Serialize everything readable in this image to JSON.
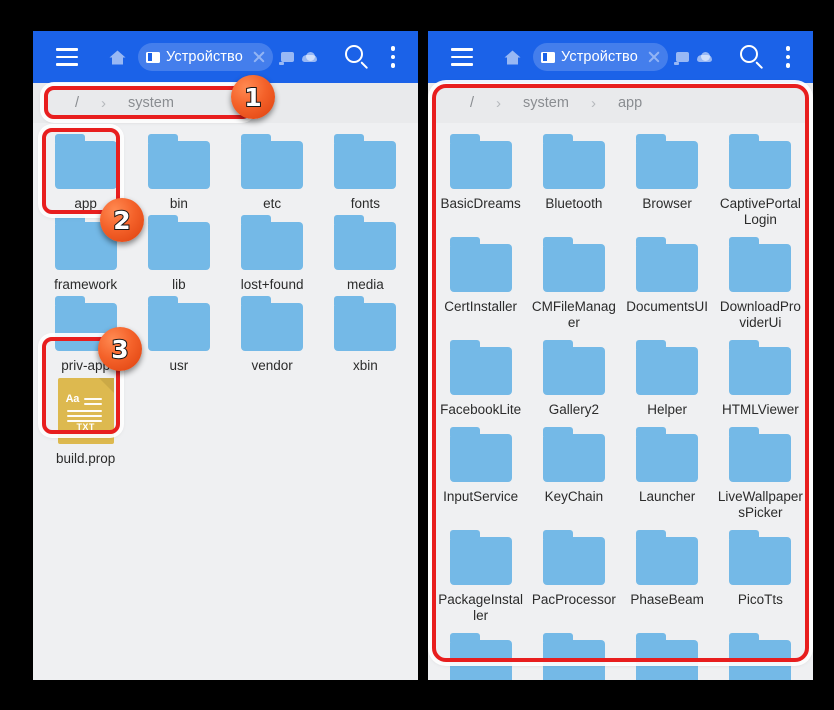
{
  "toolbar": {
    "menu_icon": "hamburger-menu-icon",
    "home_icon": "home-icon",
    "tab_label": "Устройство",
    "tab_close_icon": "close-icon",
    "screen_icon": "screen-icon",
    "cloud_icon": "cloud-icon",
    "search_icon": "search-icon",
    "overflow_icon": "more-vertical-icon"
  },
  "left_panel": {
    "breadcrumb": [
      "/",
      "system"
    ],
    "separator": "›",
    "items": [
      {
        "name": "app",
        "type": "folder"
      },
      {
        "name": "bin",
        "type": "folder"
      },
      {
        "name": "etc",
        "type": "folder"
      },
      {
        "name": "fonts",
        "type": "folder"
      },
      {
        "name": "framework",
        "type": "folder"
      },
      {
        "name": "lib",
        "type": "folder"
      },
      {
        "name": "lost+found",
        "type": "folder"
      },
      {
        "name": "media",
        "type": "folder"
      },
      {
        "name": "priv-app",
        "type": "folder"
      },
      {
        "name": "usr",
        "type": "folder"
      },
      {
        "name": "vendor",
        "type": "folder"
      },
      {
        "name": "xbin",
        "type": "folder"
      },
      {
        "name": "build.prop",
        "type": "txt-file",
        "ext_label": "TXT",
        "sample_text": "Aa"
      }
    ]
  },
  "right_panel": {
    "breadcrumb": [
      "/",
      "system",
      "app"
    ],
    "separator": "›",
    "items": [
      {
        "name": "BasicDreams",
        "type": "folder"
      },
      {
        "name": "Bluetooth",
        "type": "folder"
      },
      {
        "name": "Browser",
        "type": "folder"
      },
      {
        "name": "CaptivePortalLogin",
        "type": "folder"
      },
      {
        "name": "CertInstaller",
        "type": "folder"
      },
      {
        "name": "CMFileManager",
        "type": "folder"
      },
      {
        "name": "DocumentsUI",
        "type": "folder"
      },
      {
        "name": "DownloadProviderUi",
        "type": "folder"
      },
      {
        "name": "FacebookLite",
        "type": "folder"
      },
      {
        "name": "Gallery2",
        "type": "folder"
      },
      {
        "name": "Helper",
        "type": "folder"
      },
      {
        "name": "HTMLViewer",
        "type": "folder"
      },
      {
        "name": "InputService",
        "type": "folder"
      },
      {
        "name": "KeyChain",
        "type": "folder"
      },
      {
        "name": "Launcher",
        "type": "folder"
      },
      {
        "name": "LiveWallpapersPicker",
        "type": "folder"
      },
      {
        "name": "PackageInstaller",
        "type": "folder"
      },
      {
        "name": "PacProcessor",
        "type": "folder"
      },
      {
        "name": "PhaseBeam",
        "type": "folder"
      },
      {
        "name": "PicoTts",
        "type": "folder"
      }
    ]
  },
  "annotations": {
    "badges": [
      {
        "number": "1",
        "target": "breadcrumb-bar-left"
      },
      {
        "number": "2",
        "target": "folder-app"
      },
      {
        "number": "3",
        "target": "folder-priv-app"
      }
    ]
  },
  "colors": {
    "toolbar_blue": "#1b62e8",
    "folder_blue": "#74b9e7",
    "panel_bg": "#eff0f2",
    "highlight_red": "#e81e1e",
    "badge_orange": "#f4622a",
    "txt_file_gold": "#ddb94f"
  }
}
